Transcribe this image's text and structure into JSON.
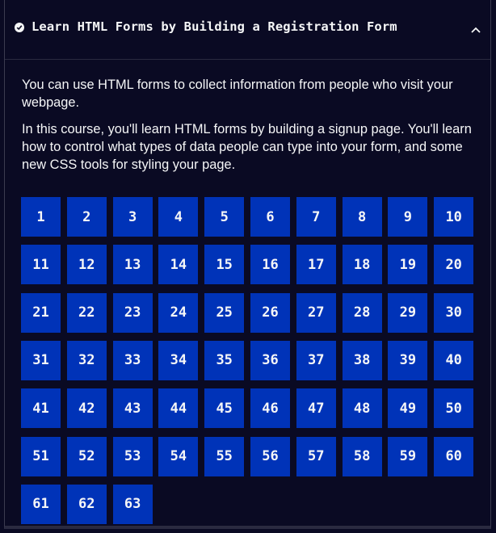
{
  "header": {
    "title": "Learn HTML Forms by Building a Registration Form",
    "status_icon": "check-circle-icon",
    "toggle_icon": "chevron-up-icon"
  },
  "intro": {
    "paragraphs": [
      "You can use HTML forms to collect information from people who visit your webpage.",
      "In this course, you'll learn HTML forms by building a signup page. You'll learn how to control what types of data people can type into your form, and some new CSS tools for styling your page."
    ]
  },
  "steps": [
    "1",
    "2",
    "3",
    "4",
    "5",
    "6",
    "7",
    "8",
    "9",
    "10",
    "11",
    "12",
    "13",
    "14",
    "15",
    "16",
    "17",
    "18",
    "19",
    "20",
    "21",
    "22",
    "23",
    "24",
    "25",
    "26",
    "27",
    "28",
    "29",
    "30",
    "31",
    "32",
    "33",
    "34",
    "35",
    "36",
    "37",
    "38",
    "39",
    "40",
    "41",
    "42",
    "43",
    "44",
    "45",
    "46",
    "47",
    "48",
    "49",
    "50",
    "51",
    "52",
    "53",
    "54",
    "55",
    "56",
    "57",
    "58",
    "59",
    "60",
    "61",
    "62",
    "63"
  ],
  "colors": {
    "background": "#0a0a23",
    "step_button": "#0033b8",
    "text": "#f5f6f7"
  }
}
